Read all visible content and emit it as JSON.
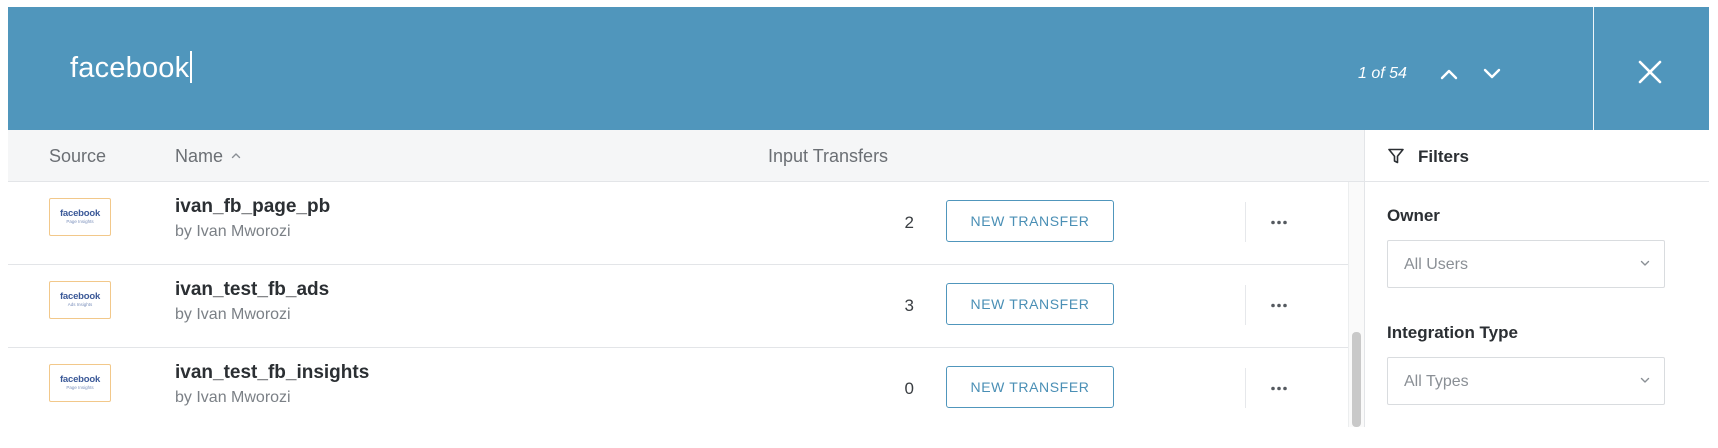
{
  "search": {
    "query": "facebook",
    "match_count": "1 of 54"
  },
  "icons": {
    "prev_match": "chevron-up-icon",
    "next_match": "chevron-down-icon",
    "close": "close-icon",
    "sort": "sort-ascending-icon",
    "more": "ellipsis-icon",
    "filter": "funnel-icon",
    "dropdown": "chevron-down-icon"
  },
  "table": {
    "columns": {
      "source": "Source",
      "name": "Name",
      "input_transfers": "Input Transfers"
    },
    "rows": [
      {
        "logo_text": "facebook",
        "logo_sub": "Page Insights",
        "name": "ivan_fb_page_pb",
        "owner": "by Ivan Mworozi",
        "input_transfers": "2",
        "action": "NEW TRANSFER"
      },
      {
        "logo_text": "facebook",
        "logo_sub": "Ads Insights",
        "name": "ivan_test_fb_ads",
        "owner": "by Ivan Mworozi",
        "input_transfers": "3",
        "action": "NEW TRANSFER"
      },
      {
        "logo_text": "facebook",
        "logo_sub": "Page Insights",
        "name": "ivan_test_fb_insights",
        "owner": "by Ivan Mworozi",
        "input_transfers": "0",
        "action": "NEW TRANSFER"
      }
    ]
  },
  "filters": {
    "title": "Filters",
    "owner": {
      "label": "Owner",
      "value": "All Users"
    },
    "integration_type": {
      "label": "Integration Type",
      "value": "All Types"
    }
  },
  "colors": {
    "header_bg": "#5096bc",
    "accent": "#4a8fb5",
    "logo_border": "#f2c88a",
    "facebook_blue": "#3b5998"
  }
}
